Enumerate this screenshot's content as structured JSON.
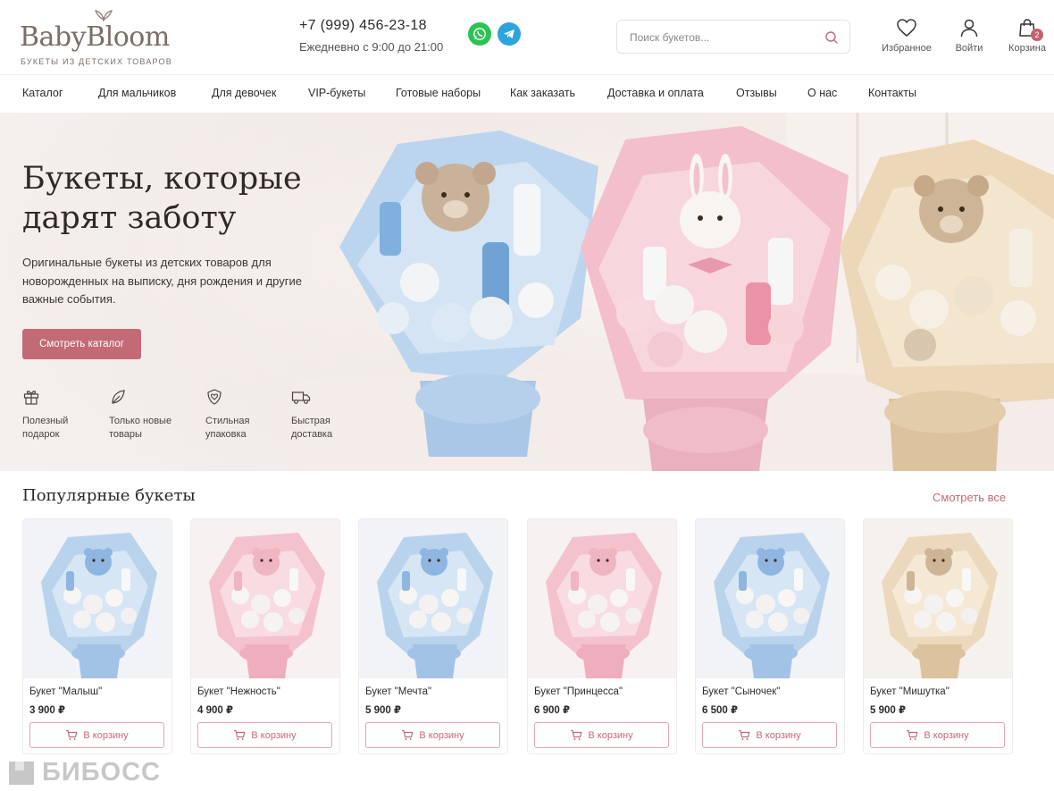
{
  "header": {
    "logo_text": "BabyBloom",
    "logo_sub": "БУКЕТЫ ИЗ ДЕТСКИХ ТОВАРОВ",
    "phone": "+7 (999) 456-23-18",
    "hours": "Ежедневно с 9:00 до 21:00",
    "search_placeholder": "Поиск букетов...",
    "favorites_label": "Избранное",
    "login_label": "Войти",
    "cart_label": "Корзина",
    "cart_count": "2",
    "messengers": [
      "whatsapp-icon",
      "telegram-icon"
    ]
  },
  "nav": {
    "items": [
      "Каталог",
      "Для мальчиков",
      "Для девочек",
      "VIP-букеты",
      "Готовые наборы",
      "Как заказать",
      "Доставка и оплата",
      "Отзывы",
      "О нас",
      "Контакты"
    ]
  },
  "hero": {
    "title": "Букеты, которые дарят заботу",
    "description": "Оригинальные букеты из детских товаров для новорожденных на выписку, дня рождения и другие важные события.",
    "button": "Смотреть каталог",
    "features": [
      {
        "icon": "gift-icon",
        "label": "Полезный подарок"
      },
      {
        "icon": "leaf-icon",
        "label": "Только новые товары"
      },
      {
        "icon": "heart-shield-icon",
        "label": "Стильная упаковка"
      },
      {
        "icon": "truck-icon",
        "label": "Быстрая доставка"
      }
    ]
  },
  "popular": {
    "title": "Популярные букеты",
    "see_all": "Смотреть все",
    "add_to_cart_label": "В корзину",
    "products": [
      {
        "name": "Букет \"Малыш\"",
        "price": "3 900 ₽",
        "tone": "blue"
      },
      {
        "name": "Букет \"Нежность\"",
        "price": "4 900 ₽",
        "tone": "pink"
      },
      {
        "name": "Букет \"Мечта\"",
        "price": "5 900 ₽",
        "tone": "blue"
      },
      {
        "name": "Букет \"Принцесса\"",
        "price": "6 900 ₽",
        "tone": "pink"
      },
      {
        "name": "Букет \"Сыночек\"",
        "price": "6 500 ₽",
        "tone": "blue"
      },
      {
        "name": "Букет \"Мишутка\"",
        "price": "5 900 ₽",
        "tone": "beige"
      }
    ]
  },
  "colors": {
    "accent": "#c36a77",
    "blue_wrap": "#b9d3ec",
    "pink_wrap": "#f3c2cc",
    "beige_wrap": "#ecd9bd"
  },
  "watermark": "БИБОСС"
}
